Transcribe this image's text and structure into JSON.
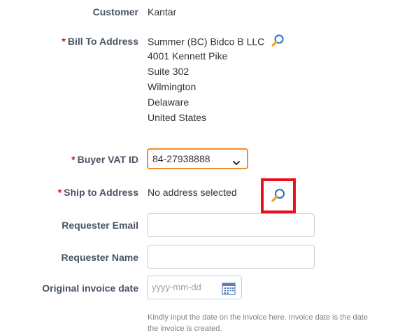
{
  "fields": {
    "customer": {
      "label": "Customer",
      "value": "Kantar"
    },
    "bill_to": {
      "label": "Bill To Address",
      "required_mark": "*",
      "lines": [
        "Summer (BC) Bidco B LLC",
        "4001 Kennett Pike",
        "Suite 302",
        "Wilmington",
        "Delaware",
        "United States"
      ]
    },
    "buyer_vat": {
      "label": "Buyer VAT ID",
      "required_mark": "*",
      "selected": "84-27938888"
    },
    "ship_to": {
      "label": "Ship to Address",
      "required_mark": "*",
      "value": "No address selected"
    },
    "requester_email": {
      "label": "Requester Email",
      "value": ""
    },
    "requester_name": {
      "label": "Requester Name",
      "value": ""
    },
    "original_invoice_date": {
      "label": "Original invoice date",
      "placeholder": "yyyy-mm-dd",
      "help": "Kindly input the date on the invoice here. Invoice date is the date the invoice is created."
    }
  },
  "colors": {
    "accent_orange": "#f08c2b",
    "required_red": "#e2101b",
    "label": "#485363",
    "highlight_red": "#e8101c"
  },
  "icons": {
    "search": "magnifier-icon",
    "dropdown": "chevron-down-icon",
    "calendar": "calendar-icon"
  }
}
